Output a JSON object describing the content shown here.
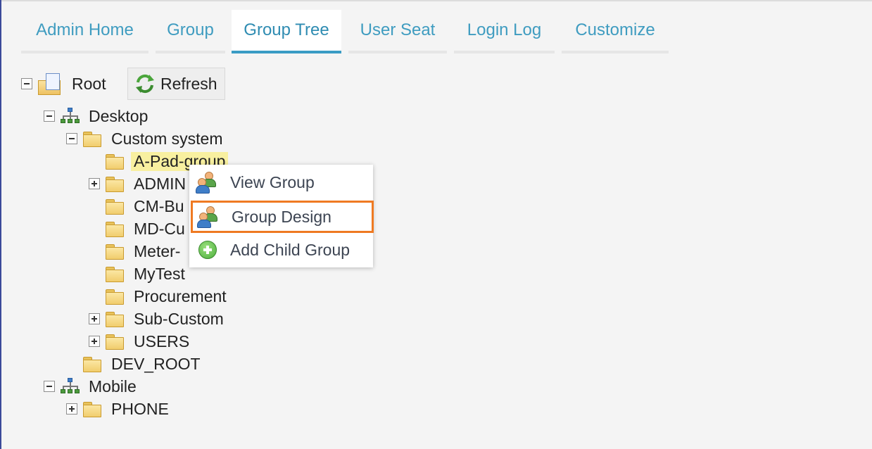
{
  "tabs": [
    {
      "label": "Admin Home"
    },
    {
      "label": "Group"
    },
    {
      "label": "Group Tree",
      "active": true
    },
    {
      "label": "User Seat"
    },
    {
      "label": "Login Log"
    },
    {
      "label": "Customize"
    }
  ],
  "toolbar": {
    "refresh_label": "Refresh"
  },
  "tree": {
    "root": "Root",
    "desktop": "Desktop",
    "custom_system": "Custom system",
    "custom_children": [
      "A-Pad-group",
      "ADMIN",
      "CM-Bu",
      "MD-Cu",
      "Meter-",
      "MyTest",
      "Procurement",
      "Sub-Custom",
      "USERS"
    ],
    "dev_root": "DEV_ROOT",
    "mobile": "Mobile",
    "phone": "PHONE"
  },
  "context_menu": {
    "items": [
      {
        "label": "View Group",
        "icon": "users-icon"
      },
      {
        "label": "Group Design",
        "icon": "users-icon",
        "highlighted": true
      },
      {
        "label": "Add Child Group",
        "icon": "add-circle-icon"
      }
    ]
  },
  "colors": {
    "accent": "#3a9cc4",
    "highlight_border": "#ef7a22",
    "selection_bg": "#f8f0a0"
  }
}
